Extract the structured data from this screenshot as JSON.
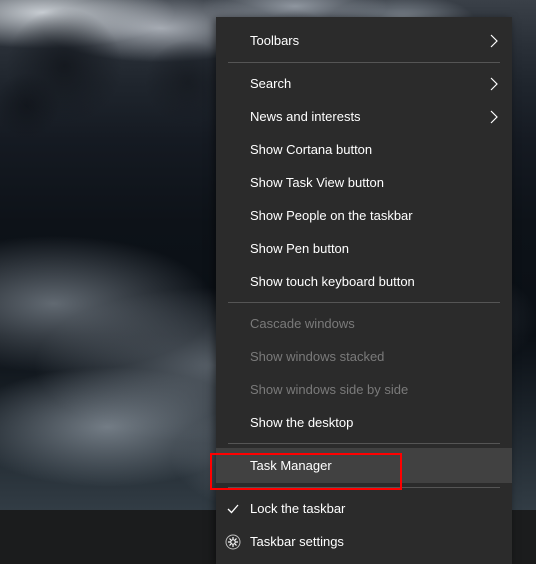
{
  "menu": {
    "toolbars": "Toolbars",
    "search": "Search",
    "news": "News and interests",
    "cortana": "Show Cortana button",
    "taskview": "Show Task View button",
    "people": "Show People on the taskbar",
    "pen": "Show Pen button",
    "touchkb": "Show touch keyboard button",
    "cascade": "Cascade windows",
    "stacked": "Show windows stacked",
    "sidebyside": "Show windows side by side",
    "showdesktop": "Show the desktop",
    "taskmgr": "Task Manager",
    "lock": "Lock the taskbar",
    "settings": "Taskbar settings"
  }
}
